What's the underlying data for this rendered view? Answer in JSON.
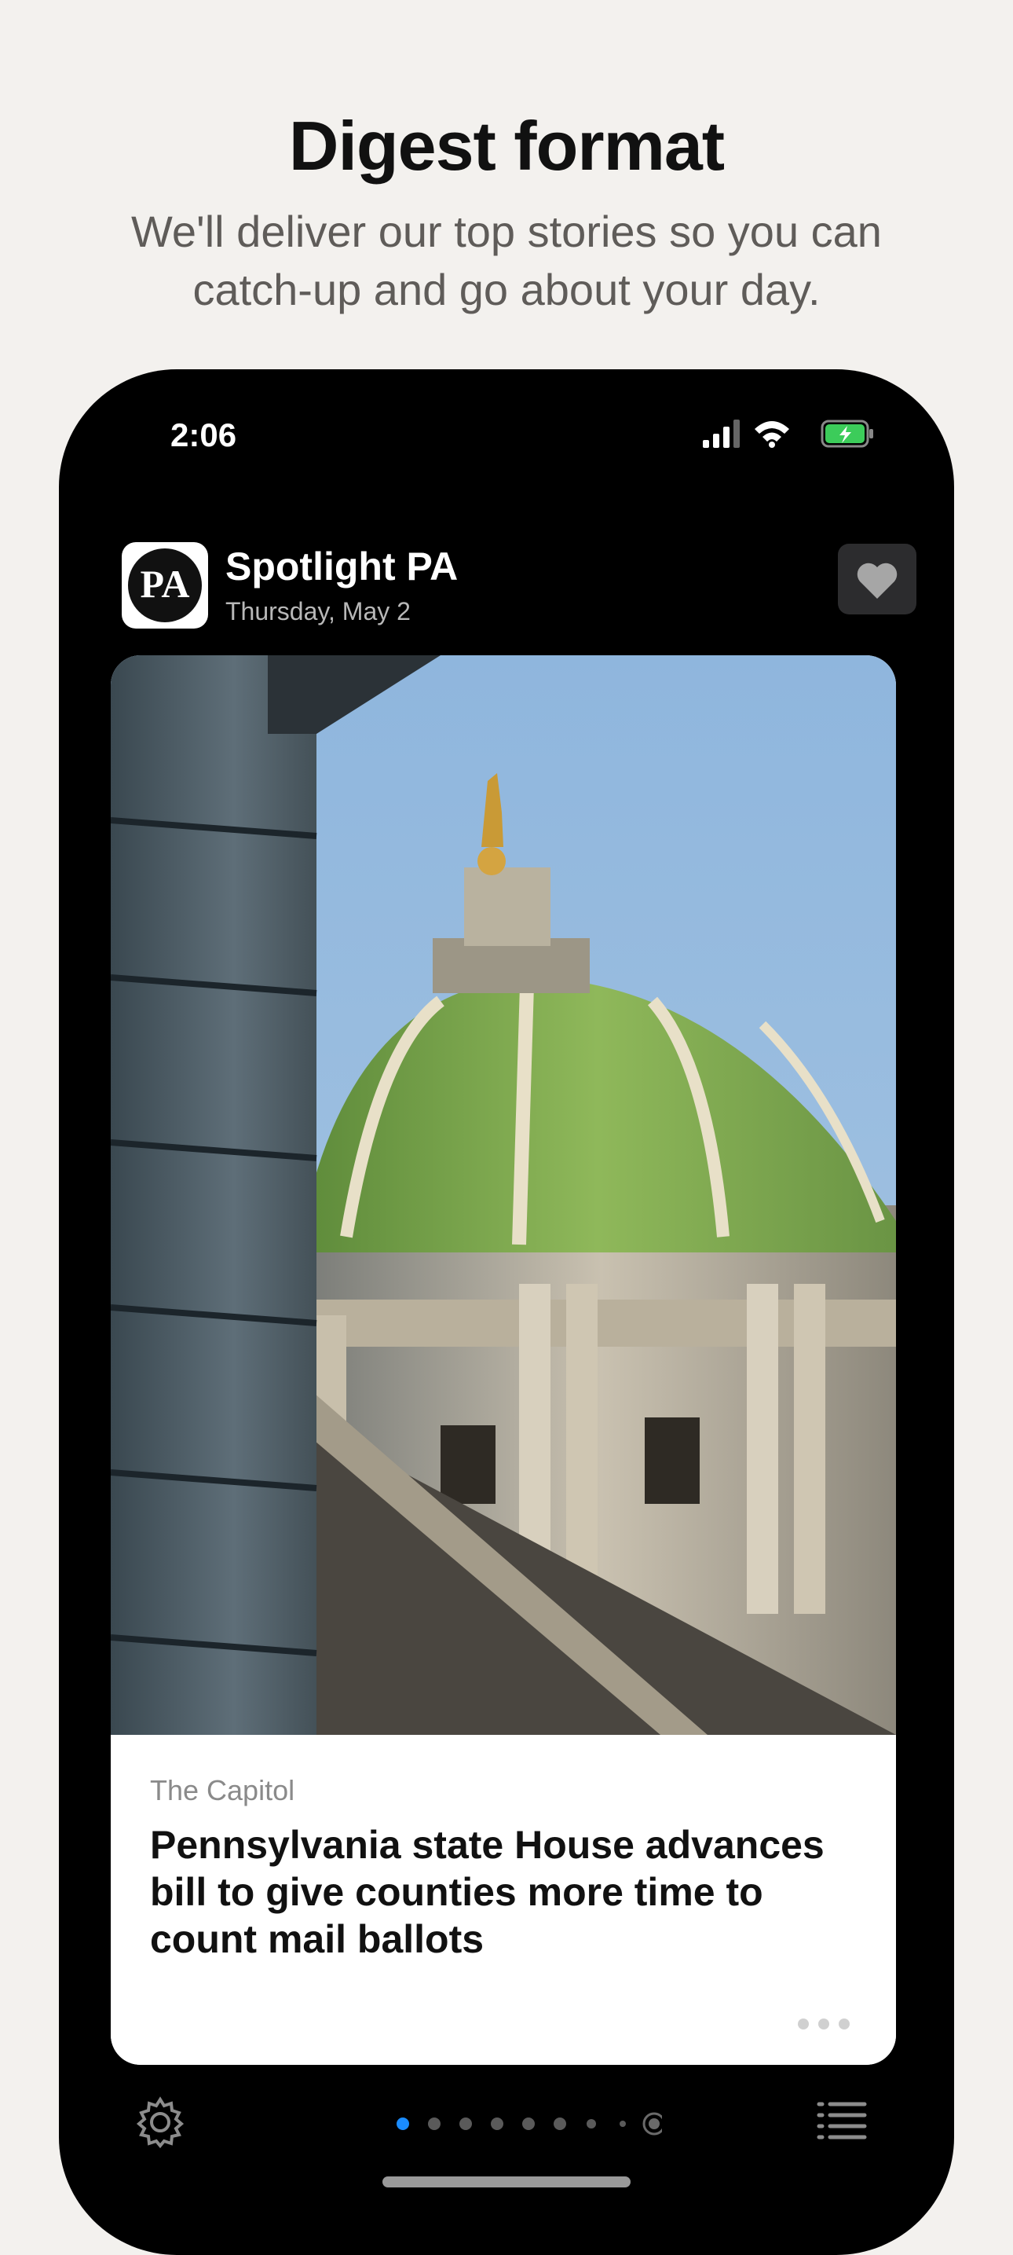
{
  "intro": {
    "headline": "Digest format",
    "subhead": "We'll deliver our top stories so you can catch-up and go about your day."
  },
  "status_bar": {
    "time": "2:06",
    "icons": [
      "cellular-signal-icon",
      "wifi-icon",
      "battery-charging-icon"
    ]
  },
  "app_header": {
    "logo_text": "PA",
    "name": "Spotlight PA",
    "date": "Thursday, May 2",
    "favorite_icon": "heart-icon"
  },
  "story": {
    "section": "The Capitol",
    "title": "Pennsylvania state House advances bill to give counties more time to count mail ballots",
    "more_icon": "more-dots-icon"
  },
  "pager": {
    "total": 9,
    "active_index": 0
  },
  "bottom_bar": {
    "left_icon": "gear-icon",
    "right_icon": "list-icon"
  },
  "colors": {
    "background": "#f3f1ee",
    "accent": "#1a8cff",
    "phone": "#000000"
  }
}
